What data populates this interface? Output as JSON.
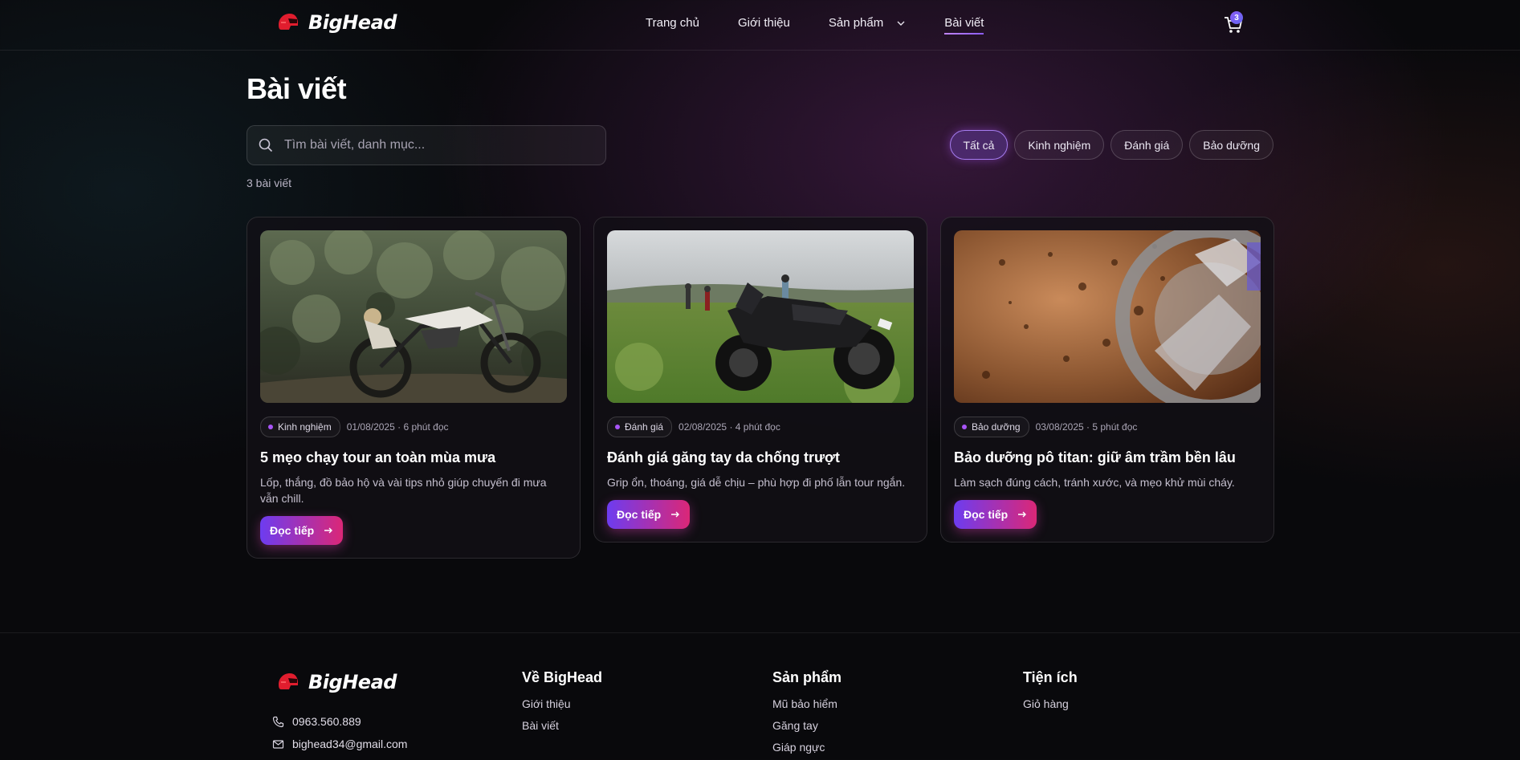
{
  "brand": {
    "name": "BigHead"
  },
  "nav": {
    "items": [
      {
        "label": "Trang chủ"
      },
      {
        "label": "Giới thiệu"
      },
      {
        "label": "Sản phẩm"
      },
      {
        "label": "Bài viết"
      }
    ],
    "active": "Bài viết"
  },
  "cart": {
    "count": "3"
  },
  "page": {
    "title": "Bài viết",
    "search_placeholder": "Tìm bài viết, danh mục...",
    "count_text": "3 bài viết"
  },
  "filters": [
    "Tất cả",
    "Kinh nghiệm",
    "Đánh giá",
    "Bảo dưỡng"
  ],
  "articles": [
    {
      "tag": "Kinh nghiệm",
      "meta": "01/08/2025 · 6 phút đọc",
      "title": "5 mẹo chạy tour an toàn mùa mưa",
      "excerpt": "Lốp, thắng, đồ bảo hộ và vài tips nhỏ giúp chuyến đi mưa vẫn chill.",
      "button": "Đọc tiếp"
    },
    {
      "tag": "Đánh giá",
      "meta": "02/08/2025 · 4 phút đọc",
      "title": "Đánh giá găng tay da chống trượt",
      "excerpt": "Grip ổn, thoáng, giá dễ chịu – phù hợp đi phố lẫn tour ngắn.",
      "button": "Đọc tiếp"
    },
    {
      "tag": "Bảo dưỡng",
      "meta": "03/08/2025 · 5 phút đọc",
      "title": "Bảo dưỡng pô titan: giữ âm trầm bền lâu",
      "excerpt": "Làm sạch đúng cách, tránh xước, và mẹo khử mùi cháy.",
      "button": "Đọc tiếp"
    }
  ],
  "footer": {
    "phone": "0963.560.889",
    "email": "bighead34@gmail.com",
    "columns": [
      {
        "title": "Về BigHead",
        "links": [
          "Giới thiệu",
          "Bài viết"
        ]
      },
      {
        "title": "Sản phẩm",
        "links": [
          "Mũ bảo hiểm",
          "Găng tay",
          "Giáp ngực"
        ]
      },
      {
        "title": "Tiện ích",
        "links": [
          "Giỏ hàng"
        ]
      }
    ]
  },
  "colors": {
    "accent": "#8b5cf6",
    "accent2": "#db2777",
    "background": "#09090c"
  }
}
